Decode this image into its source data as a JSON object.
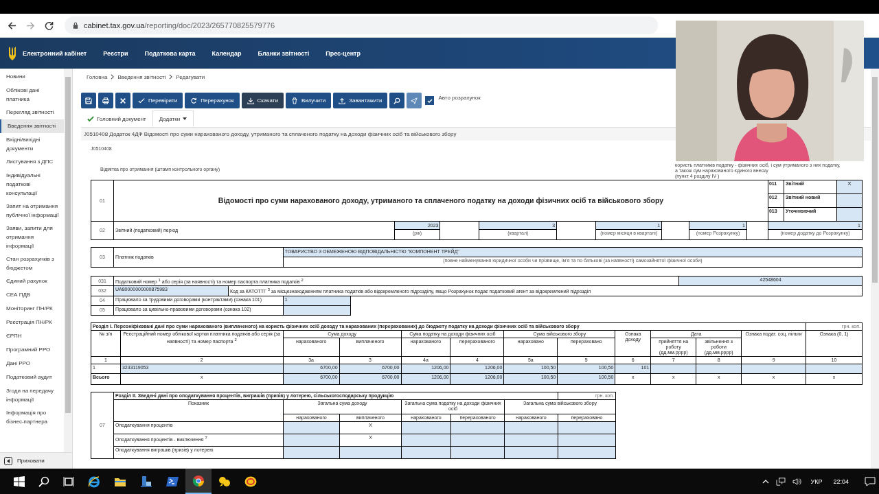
{
  "browser": {
    "url_host": "cabinet.tax.gov.ua",
    "url_path": "/reporting/doc/2023/265770825579776"
  },
  "nav": {
    "brand": "Електронний кабінет",
    "items": [
      "Реєстри",
      "Податкова карта",
      "Календар",
      "Бланки звітності",
      "Прес-центр"
    ]
  },
  "sidebar": {
    "items": [
      {
        "label": "Новини",
        "selected": false
      },
      {
        "label": "Облікові дані платника",
        "selected": false
      },
      {
        "label": "Перегляд звітності",
        "selected": false
      },
      {
        "label": "Введення звітності",
        "selected": true
      },
      {
        "label": "Вхідні/вихідні документи",
        "selected": false
      },
      {
        "label": "Листування з ДПС",
        "selected": false
      },
      {
        "label": "Індивідуальні податкові консультації",
        "selected": false
      },
      {
        "label": "Запит на отримання публічної інформації",
        "selected": false
      },
      {
        "label": "Заяви, запити для отримання інформації",
        "selected": false
      },
      {
        "label": "Стан розрахунків з бюджетом",
        "selected": false
      },
      {
        "label": "Єдиний рахунок",
        "selected": false
      },
      {
        "label": "СЕА ПДВ",
        "selected": false
      },
      {
        "label": "Моніторинг ПН/РК",
        "selected": false
      },
      {
        "label": "Реєстрація ПН/РК",
        "selected": false
      },
      {
        "label": "ЄРПН",
        "selected": false
      },
      {
        "label": "Програмний РРО",
        "selected": false
      },
      {
        "label": "Дані РРО",
        "selected": false
      },
      {
        "label": "Податковий аудит",
        "selected": false
      },
      {
        "label": "Згоди на передачу інформації",
        "selected": false
      },
      {
        "label": "Інформація про бізнес-партнера",
        "selected": false
      }
    ],
    "hide_label": "Приховати"
  },
  "breadcrumbs": [
    "Головна",
    "Введення звітності",
    "Редагувати"
  ],
  "toolbar": {
    "buttons": [
      {
        "kind": "icon",
        "active": false,
        "disabled": false
      },
      {
        "kind": "icon",
        "active": false,
        "disabled": false
      },
      {
        "kind": "icon",
        "active": false,
        "disabled": false
      },
      {
        "kind": "text",
        "label": "Перевірити",
        "active": false,
        "disabled": false
      },
      {
        "kind": "text",
        "label": "Перерахунок",
        "active": false,
        "disabled": false
      },
      {
        "kind": "text",
        "label": "Скачати",
        "active": true,
        "disabled": false
      },
      {
        "kind": "text",
        "label": "Вилучити",
        "active": false,
        "disabled": false
      },
      {
        "kind": "text",
        "label": "Завантажити",
        "active": false,
        "disabled": false
      },
      {
        "kind": "icon",
        "active": false,
        "disabled": false
      },
      {
        "kind": "icon",
        "active": false,
        "disabled": true
      }
    ],
    "auto_calc": {
      "label": "Авто розрахунок",
      "checked": true
    }
  },
  "tabs": [
    {
      "label": "Головний документ",
      "selected": false,
      "valid": true
    },
    {
      "label": "Додатки",
      "selected": true,
      "valid": false
    }
  ],
  "doc_title": "J0510408 Додаток 4ДФ Відомості про суми нарахованого доходу, утриманого та сплаченого податку на доходи фізичних осіб та військового збору",
  "form": {
    "code": "J0510408",
    "stamp": "Відмітка про отримання (штамп контрольного органу)",
    "note": [
      "користь платників податку - фізичних осіб, і сум утриманого з них податку,",
      "а також сум нарахованого єдиного внеску",
      "(пункт 4 розділу IV )"
    ],
    "row01": {
      "num": "01",
      "title": "Відомості про суми нарахованого доходу, утриманого та сплаченого податку на доходи фізичних осіб та військового збору",
      "types": [
        {
          "code": "011",
          "label": "Звітний",
          "value": "X"
        },
        {
          "code": "012",
          "label": "Звітний новий"
        },
        {
          "code": "013",
          "label": "Уточнюючий"
        }
      ]
    },
    "row02": {
      "num": "02",
      "label": "Звітний (податковий) період",
      "fields": [
        {
          "value": "2023",
          "caption": "(рік)"
        },
        {
          "value": "3",
          "caption": "(квартал)"
        },
        {
          "value": "1",
          "caption": "(номер місяця в кварталі)"
        },
        {
          "value": "1",
          "caption": "(номер Розрахунку)"
        },
        {
          "value": "1",
          "caption": "(номер додатку до Розрахунку)"
        }
      ]
    },
    "row03": {
      "num": "03",
      "label": "Платник податків",
      "value": "ТОВАРИСТВО З ОБМЕЖЕНОЮ ВІДПОВІДАЛЬНІСТЮ \"КОМПОНЕНТ ТРЕЙД\"",
      "caption": "(повне найменування юридичної особи чи прізвище, ім'я та по батькові (за наявності) самозайнятої фізичної особи)"
    },
    "row031": {
      "num": "031",
      "label": "Податковий номер $^{1}$ або серія (за наявності) та номер паспорта платника податків $^{2}$",
      "value": "42548604"
    },
    "row032": {
      "num": "032",
      "value": "UA80000000000875983",
      "label": "Код за КАТОТТГ $^{3}$ за місцезнаходженням платника податків або відокремленого підрозділу, якщо Розрахунок подає податковий агент за відокремлений підрозділ"
    },
    "row04": {
      "num": "04",
      "label": "Працювало за трудовими договорами (контрактами) (ознака 101)",
      "value": "1"
    },
    "row05": {
      "num": "05",
      "label": "Працювало за цивільно-правовими договорами (ознака 102)"
    }
  },
  "section1": {
    "title": "Розділ І. Персоніфіковані дані про суми нарахованого (виплаченого) на користь фізичних осіб доходу та нарахованих (перерахованих) до бюджету податку на доходи фізичних осіб та військового збору",
    "unit": "грн. коп.",
    "header": {
      "num": "№ з/п",
      "id": "Реєстраційний номер облікової картки платника податків або серія (за наявності) та номер паспорта $^{2}$",
      "income": "Сума доходу",
      "tax": "Сума податку на доходи фізичних осіб",
      "military": "Сума військового збору",
      "income_sign": "Ознака доходу",
      "date": "Дата",
      "benefit": "Ознака подат. соц. пільги",
      "flag": "Ознака (0, 1)",
      "sub": [
        "нарахованого",
        "виплаченого",
        "нарахованого",
        "перерахованого",
        "нараховано",
        "перераховано",
        "прийняття на роботу (дд.мм.рррр)",
        "звільнення з роботи (дд.мм.рррр)"
      ]
    },
    "numbers": [
      "1",
      "2",
      "3а",
      "3",
      "4а",
      "4",
      "5а",
      "5",
      "6",
      "7",
      "8",
      "9",
      "10"
    ],
    "rows": [
      {
        "kind": "data",
        "cells": [
          "1",
          "3233119053",
          "6700,00",
          "6700,00",
          "1206,00",
          "1206,00",
          "100,50",
          "100,50",
          "101",
          null,
          null,
          null,
          null
        ]
      },
      {
        "kind": "total",
        "cells": [
          "Всього",
          "x",
          "6700,00",
          "6700,00",
          "1206,00",
          "1206,00",
          "100,50",
          "100,50",
          "x",
          "x",
          "x",
          "x",
          "x"
        ]
      }
    ]
  },
  "section2": {
    "num": "07",
    "title": "Розділ ІІ. Зведені дані про оподаткування процентів, виграшів (призів) у лотерею, сільськогосподарську продукцію",
    "unit": "грн. коп.",
    "indicator": "Показник",
    "groups": [
      "Загальна сума доходу",
      "Загальна сума податку на доходи фізичних осіб",
      "Загальна сума військового збору"
    ],
    "sub": [
      "нарахованого",
      "виплаченого",
      "нарахованого",
      "перерахованого",
      "нарахованого",
      "перераховано"
    ],
    "rows": [
      {
        "label": "Оподаткування процентів",
        "paid": "X"
      },
      {
        "label": "Оподаткування процентів - виключення $^{7}$",
        "paid": "X"
      },
      {
        "label": "Оподаткування виграшів (призів) у лотерею"
      }
    ]
  },
  "taskbar": {
    "language": "УКР",
    "time": "22:04"
  }
}
